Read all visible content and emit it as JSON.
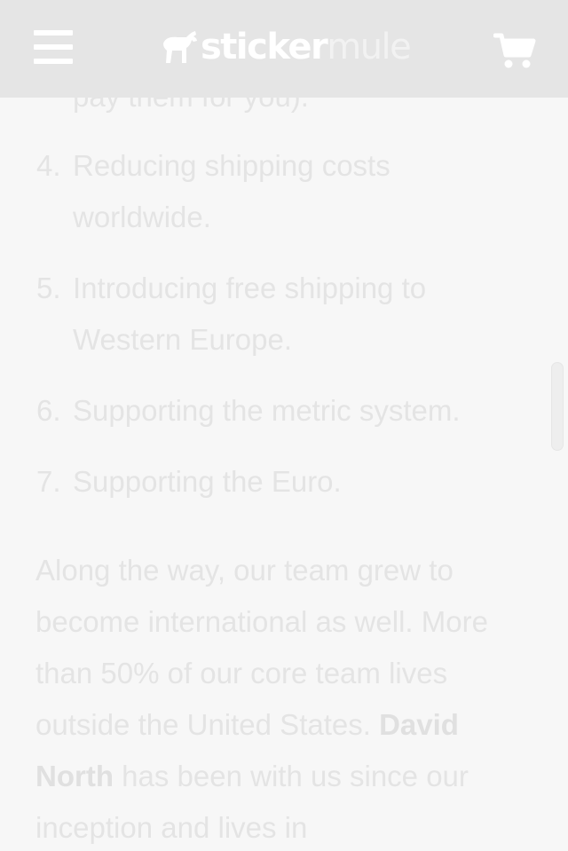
{
  "header": {
    "logo_part1": "sticker",
    "logo_part2": "mule",
    "menu_icon": "hamburger-menu-icon",
    "cart_icon": "shopping-cart-icon",
    "background_color": "#e5e5e5"
  },
  "content": {
    "partial_line": "pay them for you).",
    "list": [
      {
        "number": "4.",
        "text": "Reducing shipping costs worldwide."
      },
      {
        "number": "5.",
        "text": "Introducing free shipping to Western Europe."
      },
      {
        "number": "6.",
        "text": "Supporting the metric system."
      },
      {
        "number": "7.",
        "text": "Supporting the Euro."
      }
    ],
    "paragraph_text": "Along the way, our team grew to become international as well. More than 50% of our core team lives outside the United States.",
    "paragraph_bold": "David North",
    "paragraph_text_after": "has been with us since our inception and lives in",
    "text_color": "#e4e4e4"
  }
}
